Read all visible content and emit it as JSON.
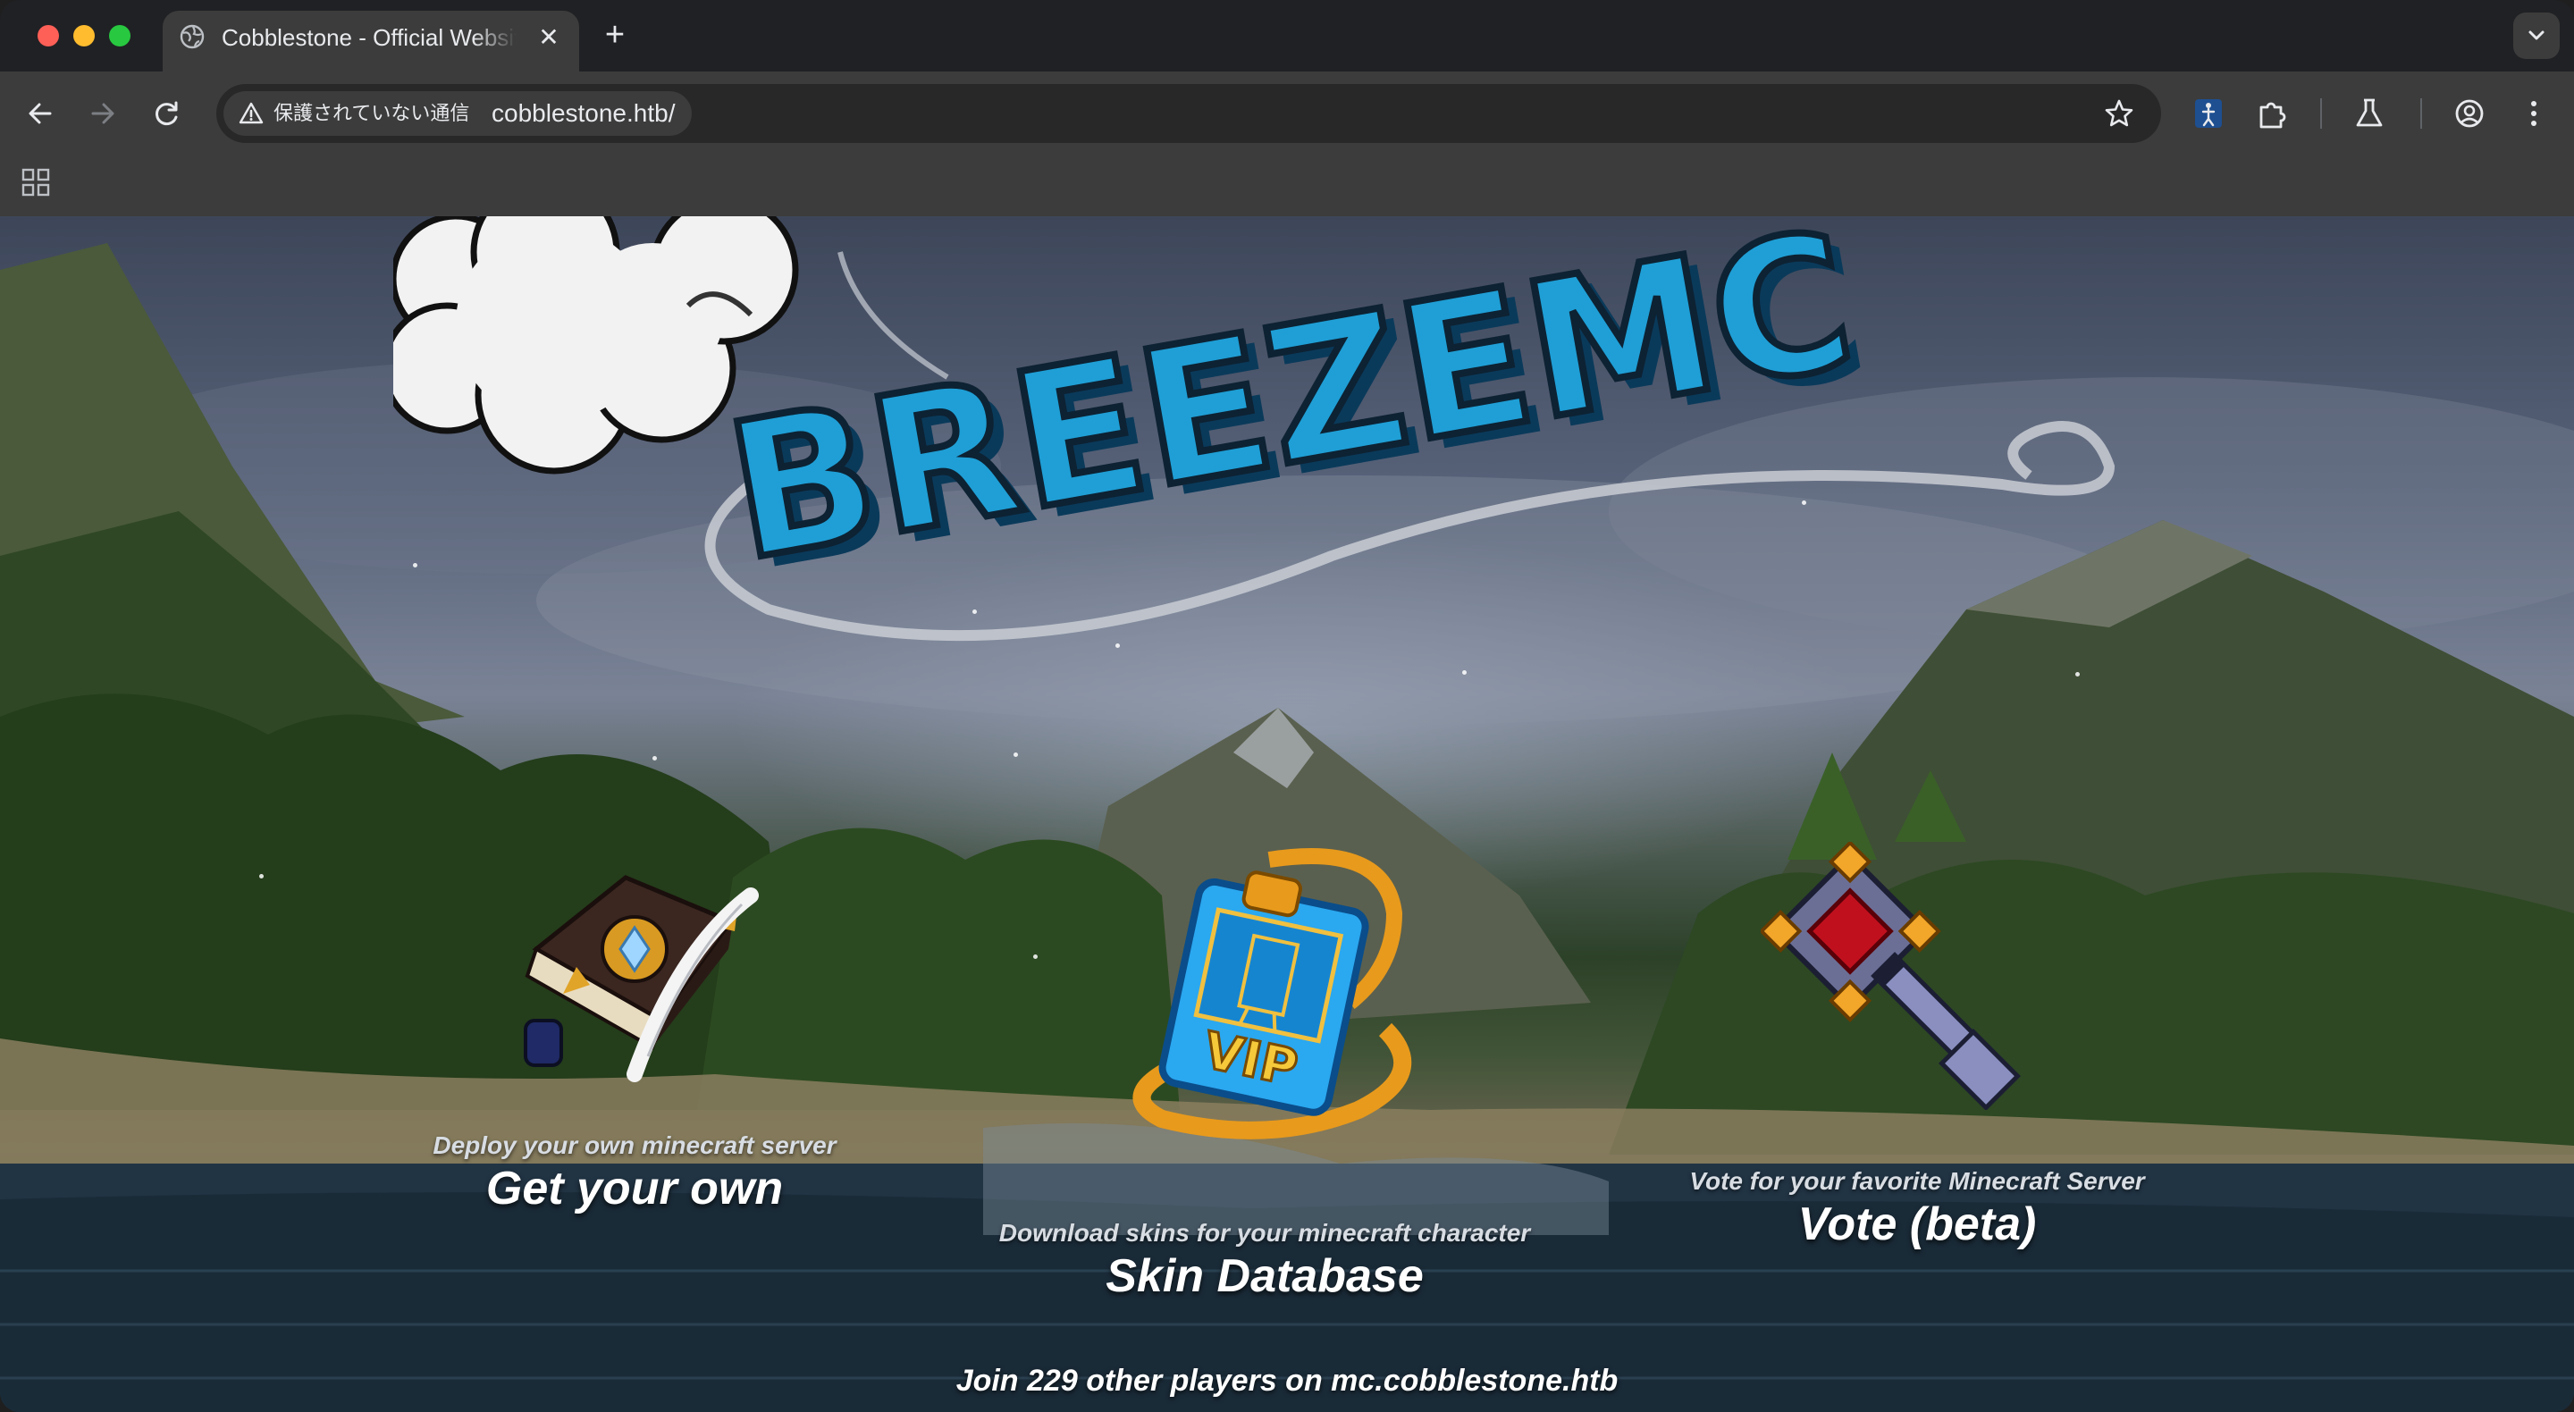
{
  "browser": {
    "tab": {
      "title": "Cobblestone - Official Website",
      "icon": "globe-icon"
    },
    "new_tab_label": "+",
    "close_label": "✕",
    "security_label": "保護されていない通信",
    "url": "cobblestone.htb/"
  },
  "page": {
    "logo_text": "BREEZEMC",
    "features": [
      {
        "subtitle": "Deploy your own minecraft server",
        "title": "Get your own"
      },
      {
        "subtitle": "Download skins for your minecraft character",
        "title": "Skin Database",
        "badge": "VIP"
      },
      {
        "subtitle": "Vote for your favorite Minecraft Server",
        "title": "Vote (beta)"
      }
    ],
    "footer": "Join 229 other players on mc.cobblestone.htb"
  },
  "colors": {
    "logo_blue": "#1f9fd6",
    "toolbar": "#3c3c3c",
    "tabstrip": "#202124"
  }
}
